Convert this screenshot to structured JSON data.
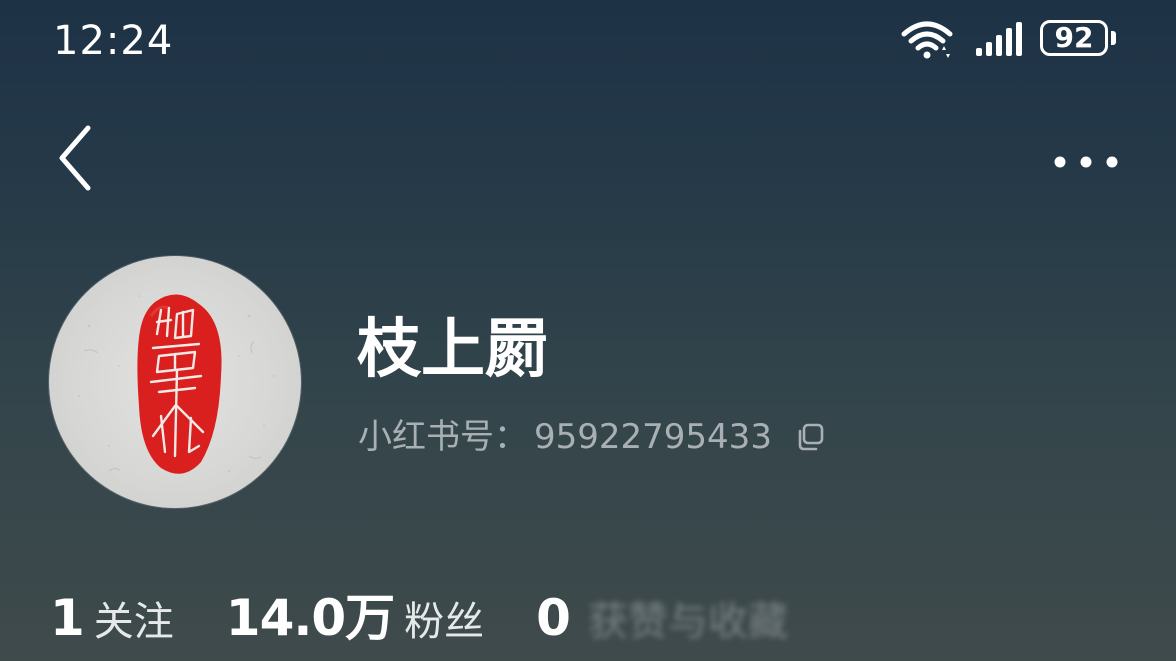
{
  "status_bar": {
    "time": "12:24",
    "wifi_icon": "wifi-icon",
    "signal_icon": "signal-icon",
    "battery_level": "92"
  },
  "nav": {
    "back_icon": "chevron-left-icon",
    "more_icon": "more-horizontal-icon"
  },
  "profile": {
    "avatar_icon": "red-seal-avatar",
    "name": "枝上罽",
    "account_label": "小红书号：",
    "account_id": "95922795433",
    "copy_icon": "copy-icon"
  },
  "stats": {
    "following_value": "1",
    "following_label": "关注",
    "fans_value": "14.0万",
    "fans_label": "粉丝",
    "likes_value": "0",
    "likes_label": "获赞与收藏"
  },
  "colors": {
    "background_top": "#1d3246",
    "background_bottom": "#3f4a4b",
    "seal_red": "#d9201e",
    "secondary_text": "#a9b0b3"
  }
}
